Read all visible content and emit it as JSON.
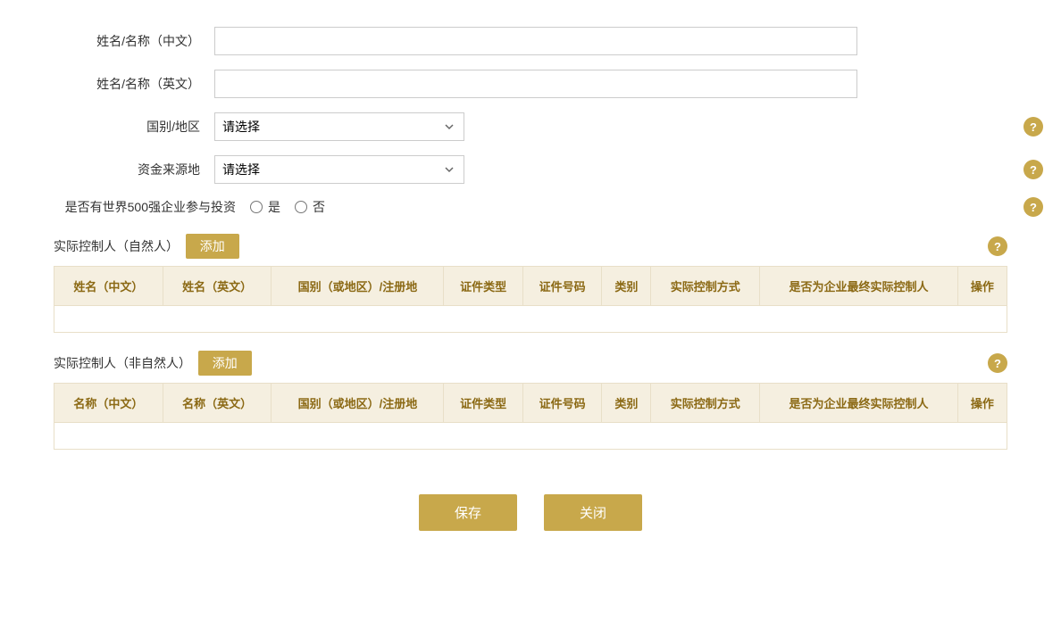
{
  "form": {
    "name_cn_label": "姓名/名称（中文）",
    "name_en_label": "姓名/名称（英文）",
    "country_label": "国别/地区",
    "country_placeholder": "请选择",
    "fund_source_label": "资金来源地",
    "fund_source_placeholder": "请选择",
    "world500_label": "是否有世界500强企业参与投资",
    "yes_label": "是",
    "no_label": "否"
  },
  "natural_person_section": {
    "title": "实际控制人（自然人）",
    "add_button": "添加",
    "help_icon": "?",
    "columns": [
      "姓名（中文）",
      "姓名（英文）",
      "国别（或地区）/注册地",
      "证件类型",
      "证件号码",
      "类别",
      "实际控制方式",
      "是否为企业最终实际控制人",
      "操作"
    ]
  },
  "non_natural_person_section": {
    "title": "实际控制人（非自然人）",
    "add_button": "添加",
    "help_icon": "?",
    "columns": [
      "名称（中文）",
      "名称（英文）",
      "国别（或地区）/注册地",
      "证件类型",
      "证件号码",
      "类别",
      "实际控制方式",
      "是否为企业最终实际控制人",
      "操作"
    ]
  },
  "buttons": {
    "save": "保存",
    "close": "关闭"
  },
  "icons": {
    "help": "?"
  }
}
